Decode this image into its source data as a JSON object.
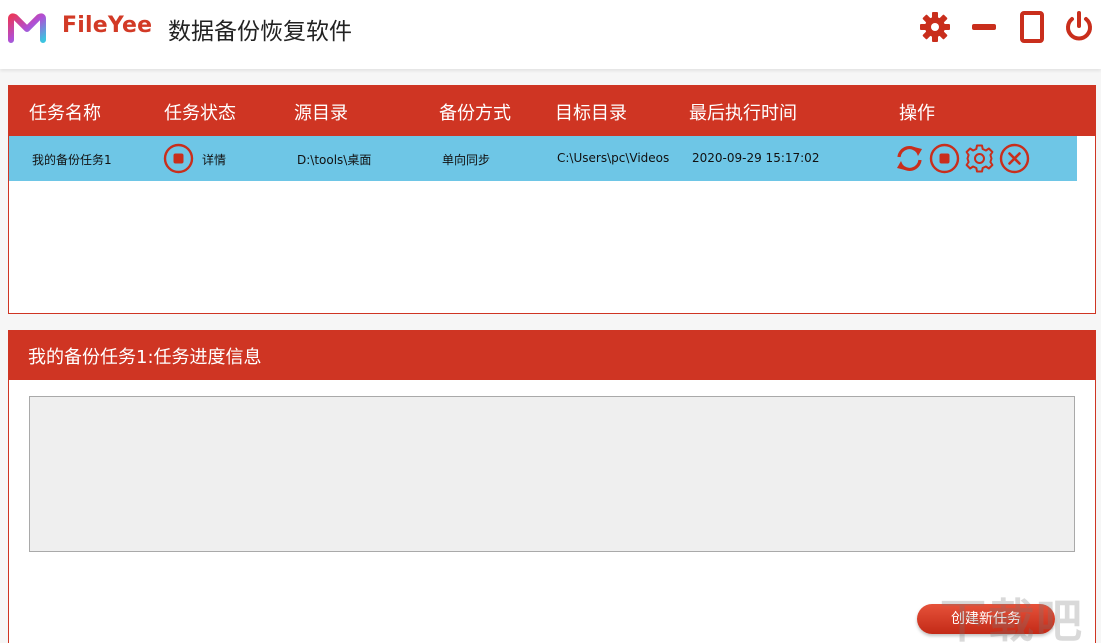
{
  "header": {
    "brand": "FileYee",
    "title": "数据备份恢复软件",
    "controls": [
      "settings-icon",
      "minimize-icon",
      "maximize-icon",
      "power-icon"
    ]
  },
  "task_table": {
    "columns": [
      "任务名称",
      "任务状态",
      "源目录",
      "备份方式",
      "目标目录",
      "最后执行时间",
      "操作"
    ],
    "rows": [
      {
        "name": "我的备份任务1",
        "status_link": "详情",
        "source": "D:\\tools\\桌面",
        "mode": "单向同步",
        "target": "C:\\Users\\pc\\Videos",
        "last_run": "2020-09-29 15:17:02",
        "ops": [
          "sync-icon",
          "stop-icon",
          "gear-icon",
          "close-icon"
        ]
      }
    ]
  },
  "progress": {
    "title": "我的备份任务1:任务进度信息",
    "log": ""
  },
  "actions": {
    "create_label": "创建新任务"
  },
  "watermark": "下载吧",
  "colors": {
    "accent": "#cf3523",
    "row_highlight": "#6ec6e6",
    "panel_bg": "#efefef"
  }
}
